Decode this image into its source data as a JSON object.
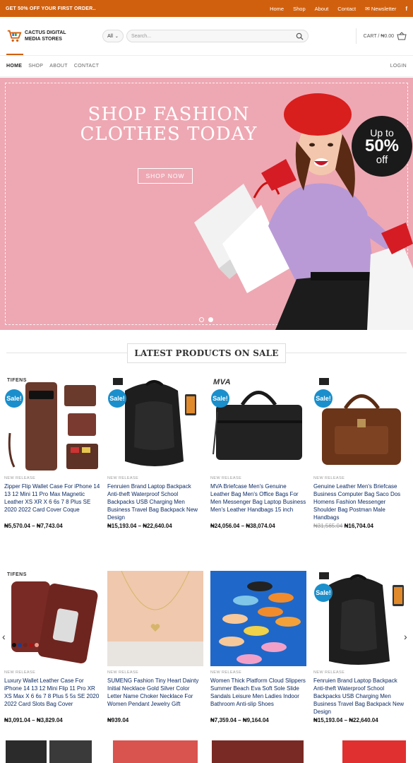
{
  "topbar": {
    "promo": "GET 50% OFF YOUR FIRST ORDER..",
    "links": [
      "Home",
      "Shop",
      "About",
      "Contact"
    ],
    "newsletter": "Newsletter",
    "facebook_icon": "f"
  },
  "header": {
    "logo_line1": "CACTUS DIGITAL",
    "logo_line2": "MEDIA STORES",
    "category": "All",
    "search_placeholder": "Search...",
    "cart": "CART / ₦0.00"
  },
  "nav": {
    "items": [
      "HOME",
      "SHOP",
      "ABOUT",
      "CONTACT"
    ],
    "login": "LOGIN"
  },
  "hero": {
    "line1": "SHOP FASHION",
    "line2": "CLOTHES TODAY",
    "cta": "SHOP NOW",
    "badge_top": "Up to",
    "badge_mid": "50%",
    "badge_bottom": "off"
  },
  "section_title": "LATEST PRODUCTS ON SALE",
  "products": [
    {
      "tag": "NEW RELEASE",
      "title": "Zipper Flip Wallet Case For iPhone 14 13 12 Mini 11 Pro Max Magnetic Leather XS XR X 6 6s 7 8 Plus SE 2020 2022 Card Cover Coque",
      "price_low": "₦5,570.04",
      "price_high": "₦7,743.04",
      "sale": "Sale!",
      "brand": "TIFENS"
    },
    {
      "tag": "NEW RELEASE",
      "title": "Fenruien Brand Laptop Backpack Anti-theft Waterproof School Backpacks USB Charging Men Business Travel Bag Backpack New Design",
      "price_low": "₦15,193.04",
      "price_high": "₦22,640.04",
      "sale": "Sale!",
      "brand": ""
    },
    {
      "tag": "NEW RELEASE",
      "title": "MVA Briefcase Men's Genuine Leather Bag Men's Office Bags For Men Messenger Bag Laptop Business Men's Leather Handbags 15 inch",
      "price_low": "₦24,056.04",
      "price_high": "₦38,074.04",
      "sale": "Sale!",
      "brand": "MVA"
    },
    {
      "tag": "NEW RELEASE",
      "title": "Genuine Leather Men's Briefcase Business Computer Bag Saco Dos Homens Fashion Messenger Shoulder Bag Postman Male Handbags",
      "price_old": "₦31,565.04",
      "price_new": "₦16,704.04",
      "sale": "Sale!",
      "brand": ""
    },
    {
      "tag": "NEW RELEASE",
      "title": "Luxury Wallet Leather Case For iPhone 14 13 12 Mini Flip 11 Pro XR XS Max X 6 6s 7 8 Plus 5 5s SE 2020 2022 Card Slots Bag Cover",
      "price_low": "₦3,091.04",
      "price_high": "₦3,829.04",
      "sale": "",
      "brand": "TIFENS"
    },
    {
      "tag": "NEW RELEASE",
      "title": "SUMENG Fashion Tiny Heart Dainty Initial Necklace Gold Silver Color Letter Name Choker Necklace For Women Pendant Jewelry Gift",
      "price_single": "₦939.04",
      "sale": "",
      "brand": ""
    },
    {
      "tag": "NEW RELEASE",
      "title": "Women Thick Platform Cloud Slippers Summer Beach Eva Soft Sole Slide Sandals Leisure Men Ladies Indoor Bathroom Anti-slip Shoes",
      "price_low": "₦7,359.04",
      "price_high": "₦9,164.04",
      "sale": "",
      "brand": ""
    },
    {
      "tag": "NEW RELEASE",
      "title": "Fenruien Brand Laptop Backpack Anti-theft Waterproof School Backpacks USB Charging Men Business Travel Bag Backpack New Design",
      "price_low": "₦15,193.04",
      "price_high": "₦22,640.04",
      "sale": "Sale!",
      "brand": ""
    }
  ],
  "price_sep": " – ",
  "colors": {
    "accent": "#d1600e",
    "sale_badge": "#1a8fcc",
    "hero_bg": "#eea8b3",
    "title_link": "#0b2a63"
  }
}
